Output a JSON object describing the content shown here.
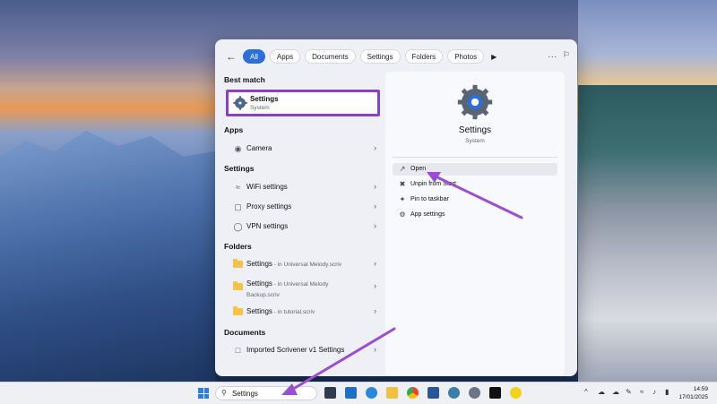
{
  "filters": {
    "back": "←",
    "chips": [
      "All",
      "Apps",
      "Documents",
      "Settings",
      "Folders",
      "Photos"
    ],
    "play": "▶",
    "more": "...",
    "feedback": "⚐"
  },
  "left": {
    "best_match_title": "Best match",
    "best_match": {
      "title": "Settings",
      "subtitle": "System"
    },
    "apps_title": "Apps",
    "apps": [
      {
        "label": "Camera"
      }
    ],
    "settings_title": "Settings",
    "settings": [
      {
        "label": "WiFi settings"
      },
      {
        "label": "Proxy settings"
      },
      {
        "label": "VPN settings"
      }
    ],
    "folders_title": "Folders",
    "folders": [
      {
        "name": "Settings",
        "location": " - in Universal Melody.scriv"
      },
      {
        "name": "Settings",
        "location": " - in Universal Melody",
        "location2": "Backup.scriv"
      },
      {
        "name": "Settings",
        "location": " - in tutorial.scriv"
      }
    ],
    "documents_title": "Documents",
    "documents": [
      {
        "label": "Imported Scrivener v1 Settings"
      }
    ]
  },
  "right": {
    "title": "Settings",
    "subtitle": "System",
    "actions": [
      {
        "label": "Open",
        "icon": "open-icon"
      },
      {
        "label": "Unpin from Start",
        "icon": "unpin-icon"
      },
      {
        "label": "Pin to taskbar",
        "icon": "pin-icon"
      },
      {
        "label": "App settings",
        "icon": "gear-icon"
      }
    ]
  },
  "taskbar": {
    "search_text": "Settings",
    "time": "14:59",
    "date": "17/01/2025",
    "tray_chevron": "^"
  },
  "colors": {
    "accent": "#2d6fd6",
    "highlight": "#8a3fc4"
  }
}
